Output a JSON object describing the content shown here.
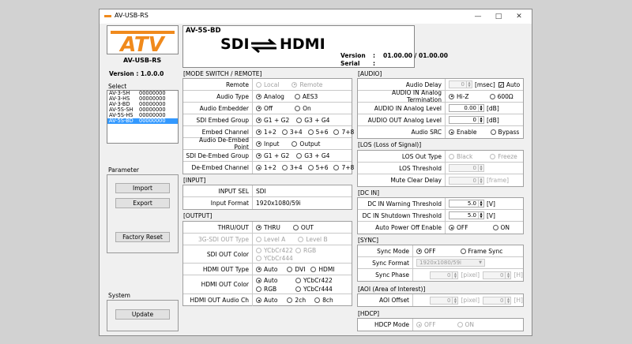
{
  "window": {
    "title": "AV-USB-RS"
  },
  "left": {
    "logo_text": "ATV",
    "app_name": "AV-USB-RS",
    "version_label": "Version : 1.0.0.0",
    "select_label": "Select",
    "devices": [
      {
        "name": "AV-3-SH",
        "serial": "00000000"
      },
      {
        "name": "AV-3-HS",
        "serial": "00000000"
      },
      {
        "name": "AV-3-BD",
        "serial": "00000000"
      },
      {
        "name": "AV-5S-SH",
        "serial": "00000000"
      },
      {
        "name": "AV-5S-HS",
        "serial": "00000000"
      },
      {
        "name": "AV-5S-BD",
        "serial": "00000000"
      }
    ],
    "parameter_label": "Parameter",
    "import_label": "Import",
    "export_label": "Export",
    "factory_reset_label": "Factory Reset",
    "system_label": "System",
    "update_label": "Update"
  },
  "header": {
    "model": "AV-5S-BD",
    "sdi": "SDI",
    "hdmi": "HDMI",
    "version_key": "Version",
    "version_val": "01.00.00 / 01.00.00",
    "serial_key": "Serial",
    "colon": ":"
  },
  "sections": {
    "mode": "[MODE SWITCH / REMOTE]",
    "input": "[INPUT]",
    "output": "[OUTPUT]",
    "audio": "[AUDIO]",
    "los": "[LOS (Loss of Signal)]",
    "dcin": "[DC IN]",
    "sync": "[SYNC]",
    "aoi": "[AOI (Area of Interest)]",
    "hdcp": "[HDCP]"
  },
  "mode": {
    "remote": {
      "k": "Remote",
      "o1": "Local",
      "o2": "Remote"
    },
    "audio_type": {
      "k": "Audio Type",
      "o1": "Analog",
      "o2": "AES3"
    },
    "audio_embedder": {
      "k": "Audio Embedder",
      "o1": "Off",
      "o2": "On"
    },
    "sdi_embed_group": {
      "k": "SDI Embed Group",
      "o1": "G1 + G2",
      "o2": "G3 + G4"
    },
    "embed_channel": {
      "k": "Embed Channel",
      "o1": "1+2",
      "o2": "3+4",
      "o3": "5+6",
      "o4": "7+8"
    },
    "deembed_point": {
      "k": "Audio De-Embed Point",
      "o1": "Input",
      "o2": "Output"
    },
    "deembed_group": {
      "k": "SDI De-Embed Group",
      "o1": "G1 + G2",
      "o2": "G3 + G4"
    },
    "deembed_channel": {
      "k": "De-Embed Channel",
      "o1": "1+2",
      "o2": "3+4",
      "o3": "5+6",
      "o4": "7+8"
    }
  },
  "input": {
    "sel": {
      "k": "INPUT SEL",
      "v": "SDI"
    },
    "format": {
      "k": "Input Format",
      "v": "1920x1080/59i"
    }
  },
  "output": {
    "thru": {
      "k": "THRU/OUT",
      "o1": "THRU",
      "o2": "OUT"
    },
    "sdi_type": {
      "k": "3G-SDI OUT Type",
      "o1": "Level A",
      "o2": "Level B"
    },
    "sdi_color": {
      "k": "SDI OUT Color",
      "o1": "YCbCr422",
      "o2": "RGB",
      "o3": "YCbCr444"
    },
    "hdmi_type": {
      "k": "HDMI OUT Type",
      "o1": "Auto",
      "o2": "DVI",
      "o3": "HDMI"
    },
    "hdmi_color": {
      "k": "HDMI OUT Color",
      "o1": "Auto",
      "o2": "YCbCr422",
      "o3": "RGB",
      "o4": "YCbCr444"
    },
    "hdmi_audio": {
      "k": "HDMI OUT Audio Ch",
      "o1": "Auto",
      "o2": "2ch",
      "o3": "8ch"
    }
  },
  "audio": {
    "delay": {
      "k": "Audio Delay",
      "v": "0",
      "unit": "[msec]",
      "auto": "Auto"
    },
    "termination": {
      "k": "AUDIO IN Analog Termination",
      "o1": "Hi-Z",
      "o2": "600Ω"
    },
    "in_level": {
      "k": "AUDIO IN Analog Level",
      "v": "0.00",
      "unit": "[dB]"
    },
    "out_level": {
      "k": "AUDIO OUT Analog Level",
      "v": "0",
      "unit": "[dB]"
    },
    "src": {
      "k": "Audio SRC",
      "o1": "Enable",
      "o2": "Bypass"
    }
  },
  "los": {
    "out_type": {
      "k": "LOS Out Type",
      "o1": "Black",
      "o2": "Freeze"
    },
    "threshold": {
      "k": "LOS Threshold",
      "v": "0"
    },
    "mute_delay": {
      "k": "Mute Clear Delay",
      "v": "0",
      "unit": "[frame]"
    }
  },
  "dcin": {
    "warn": {
      "k": "DC IN Warning Threshold",
      "v": "5.0",
      "unit": "[V]"
    },
    "shut": {
      "k": "DC IN Shutdown Threshold",
      "v": "5.0",
      "unit": "[V]"
    },
    "auto_off": {
      "k": "Auto Power Off Enable",
      "o1": "OFF",
      "o2": "ON"
    }
  },
  "sync": {
    "mode": {
      "k": "Sync Mode",
      "o1": "OFF",
      "o2": "Frame Sync"
    },
    "format": {
      "k": "Sync Format",
      "v": "1920x1080/59i"
    },
    "phase": {
      "k": "Sync Phase",
      "v1": "0",
      "u1": "[pixel]",
      "v2": "0",
      "u2": "[H]"
    }
  },
  "aoi": {
    "offset": {
      "k": "AOI Offset",
      "v1": "0",
      "u1": "[pixel]",
      "v2": "0",
      "u2": "[H]"
    }
  },
  "hdcp": {
    "mode": {
      "k": "HDCP Mode",
      "o1": "OFF",
      "o2": "ON"
    }
  }
}
